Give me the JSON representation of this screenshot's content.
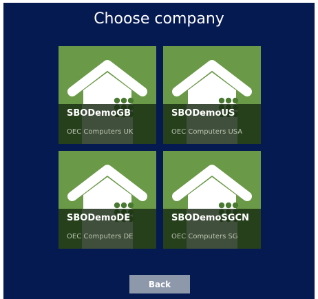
{
  "title": "Choose company",
  "companies": [
    {
      "name": "SBODemoGB",
      "description": "OEC Computers UK"
    },
    {
      "name": "SBODemoUS",
      "description": "OEC Computers USA"
    },
    {
      "name": "SBODemoDE",
      "description": "OEC Computers DE"
    },
    {
      "name": "SBODemoSGCN",
      "description": "OEC Computers SG"
    }
  ],
  "back_label": "Back",
  "colors": {
    "background": "#061a52",
    "tile": "#6a9a48",
    "house": "#ffffff",
    "band": "#142610",
    "button": "#8d98aa"
  },
  "icons": {
    "tile_icon": "house-icon"
  }
}
